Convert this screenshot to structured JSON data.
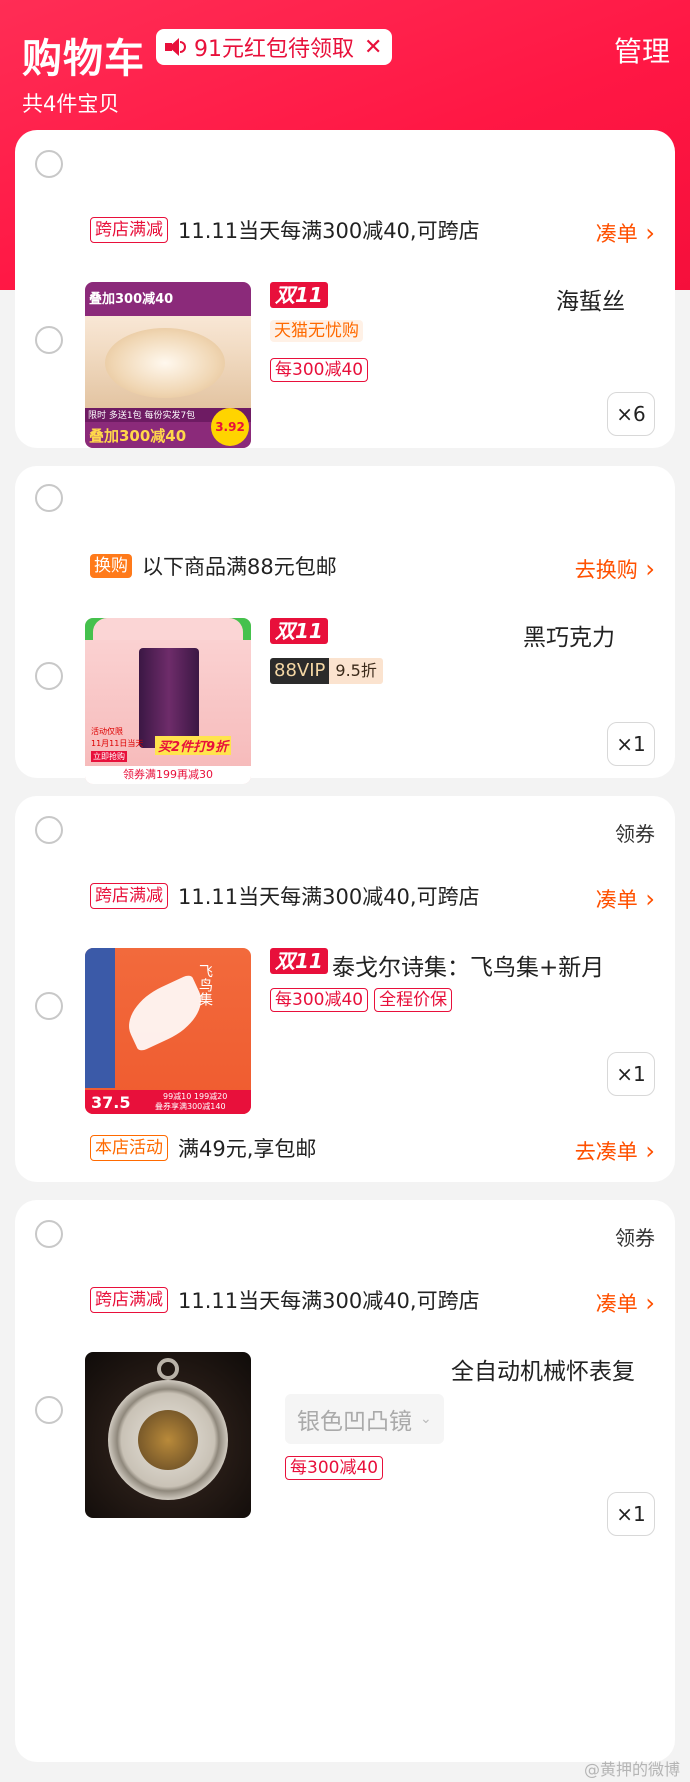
{
  "header": {
    "title": "购物车",
    "redpacket": "91元红包待领取",
    "manage": "管理",
    "count": "共4件宝贝"
  },
  "stores": [
    {
      "coupon": "",
      "promo_tag": "跨店满减",
      "promo_text": "11.11当天每满300减40,可跨店",
      "promo_link": "凑单",
      "item": {
        "badge": "双11",
        "name": "海蜇丝",
        "tags": [
          "天猫无忧购",
          "每300减40"
        ],
        "qty": "×6",
        "img_text": [
          "叠加300减40",
          "限时 多送1包 每份实发7包",
          "叠加300减40",
          "3.92"
        ]
      }
    },
    {
      "coupon": "",
      "promo_tag": "换购",
      "promo_text": "以下商品满88元包邮",
      "promo_link": "去换购",
      "item": {
        "badge": "双11",
        "name": "黑巧克力",
        "vip": "88VIP",
        "discount": "9.5折",
        "qty": "×1",
        "img_text": [
          "活动仅限",
          "11月11日当天",
          "立即抢购",
          "买2件打9折",
          "领券满199再减30"
        ]
      }
    },
    {
      "coupon": "领券",
      "promo_tag": "跨店满减",
      "promo_text": "11.11当天每满300减40,可跨店",
      "promo_link": "凑单",
      "item": {
        "badge": "双11",
        "name": "泰戈尔诗集：飞鸟集+新月",
        "tags": [
          "每300减40",
          "全程价保"
        ],
        "qty": "×1",
        "img_text": [
          "飞鸟集",
          "37.5",
          "99减10 199减20",
          "叠券享满300减140"
        ]
      },
      "footer": {
        "tag": "本店活动",
        "text": "满49元,享包邮",
        "link": "去凑单"
      }
    },
    {
      "coupon": "领券",
      "promo_tag": "跨店满减",
      "promo_text": "11.11当天每满300减40,可跨店",
      "promo_link": "凑单",
      "item": {
        "name": "全自动机械怀表复",
        "sku": "银色凹凸镜",
        "tags": [
          "每300减40"
        ],
        "qty": "×1"
      }
    }
  ],
  "watermark": "@黄押的微博",
  "colors": {
    "brand_red": "#e8103b",
    "accent_orange": "#ff5000",
    "hero_red": "#ff1744"
  }
}
